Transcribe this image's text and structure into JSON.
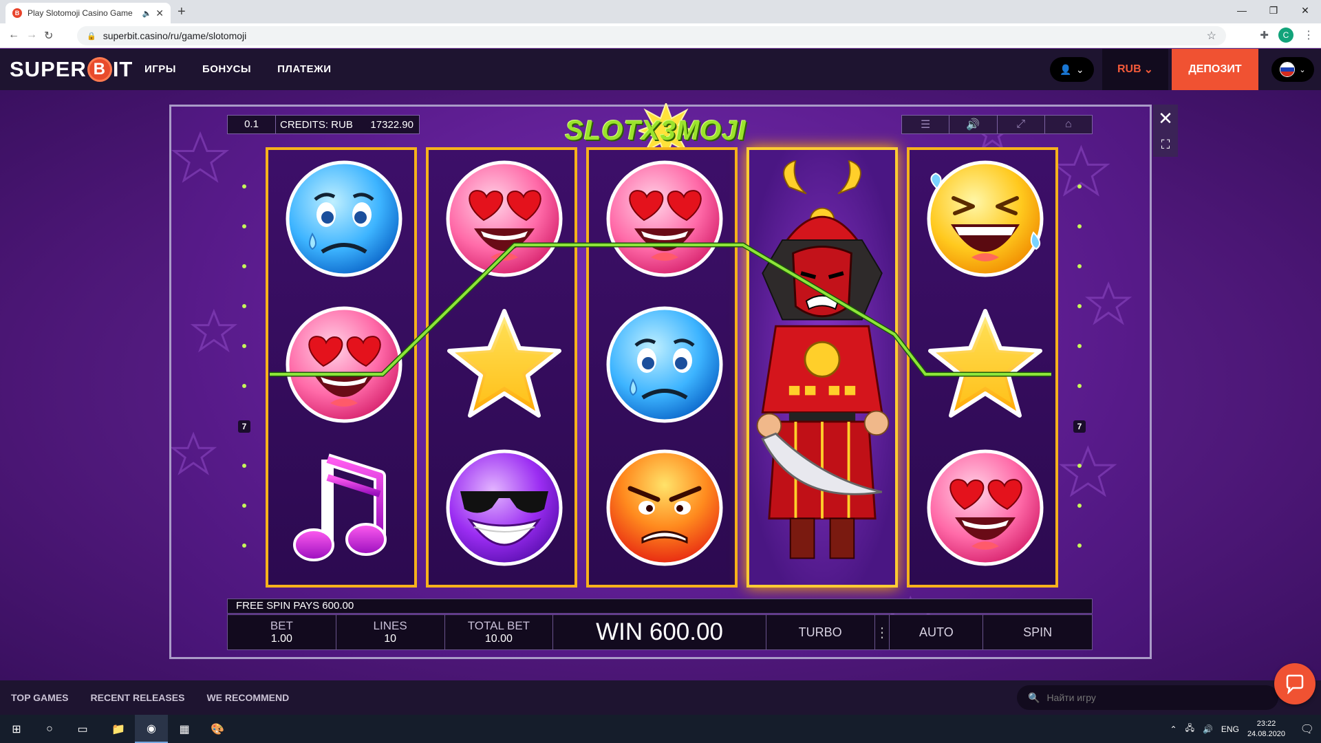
{
  "browser": {
    "tab_title": "Play Slotomoji Casino Game",
    "tab_favicon": "B",
    "url": "superbit.casino/ru/game/slotomoji",
    "profile_initial": "C"
  },
  "header": {
    "logo_left": "SUPER",
    "logo_coin": "B",
    "logo_right": "IT",
    "nav": [
      "ИГРЫ",
      "БОНУСЫ",
      "ПЛАТЕЖИ"
    ],
    "currency": "RUB",
    "deposit": "ДЕПОЗИТ"
  },
  "game": {
    "denomination": "0.1",
    "credits_label": "CREDITS: RUB",
    "credits_value": "17322.90",
    "title": "SLOTX3MOJI",
    "title_multiplier": "X3",
    "reels": [
      [
        "sad-blue-emoji",
        "heart-eyes-emoji",
        "music-note"
      ],
      [
        "heart-eyes-emoji",
        "gold-star",
        "cool-sunglasses-emoji"
      ],
      [
        "heart-eyes-emoji",
        "sad-blue-emoji",
        "angry-emoji"
      ],
      [
        "samurai-wild"
      ],
      [
        "laughing-emoji",
        "gold-star",
        "heart-eyes-emoji"
      ]
    ],
    "winning_line_number": "7",
    "free_spin_text": "FREE SPIN PAYS 600.00",
    "bet_label": "BET",
    "bet_value": "1.00",
    "lines_label": "LINES",
    "lines_value": "10",
    "total_bet_label": "TOTAL BET",
    "total_bet_value": "10.00",
    "win_text": "WIN 600.00",
    "turbo": "TURBO",
    "auto": "AUTO",
    "spin": "SPIN"
  },
  "footer": {
    "links": [
      "TOP GAMES",
      "RECENT RELEASES",
      "WE RECOMMEND"
    ],
    "search_placeholder": "Найти игру"
  },
  "taskbar": {
    "language": "ENG",
    "time": "23:22",
    "date": "24.08.2020"
  },
  "colors": {
    "brand_accent": "#f05232",
    "reel_border": "#f7b21c",
    "payline": "#8ee53a"
  }
}
